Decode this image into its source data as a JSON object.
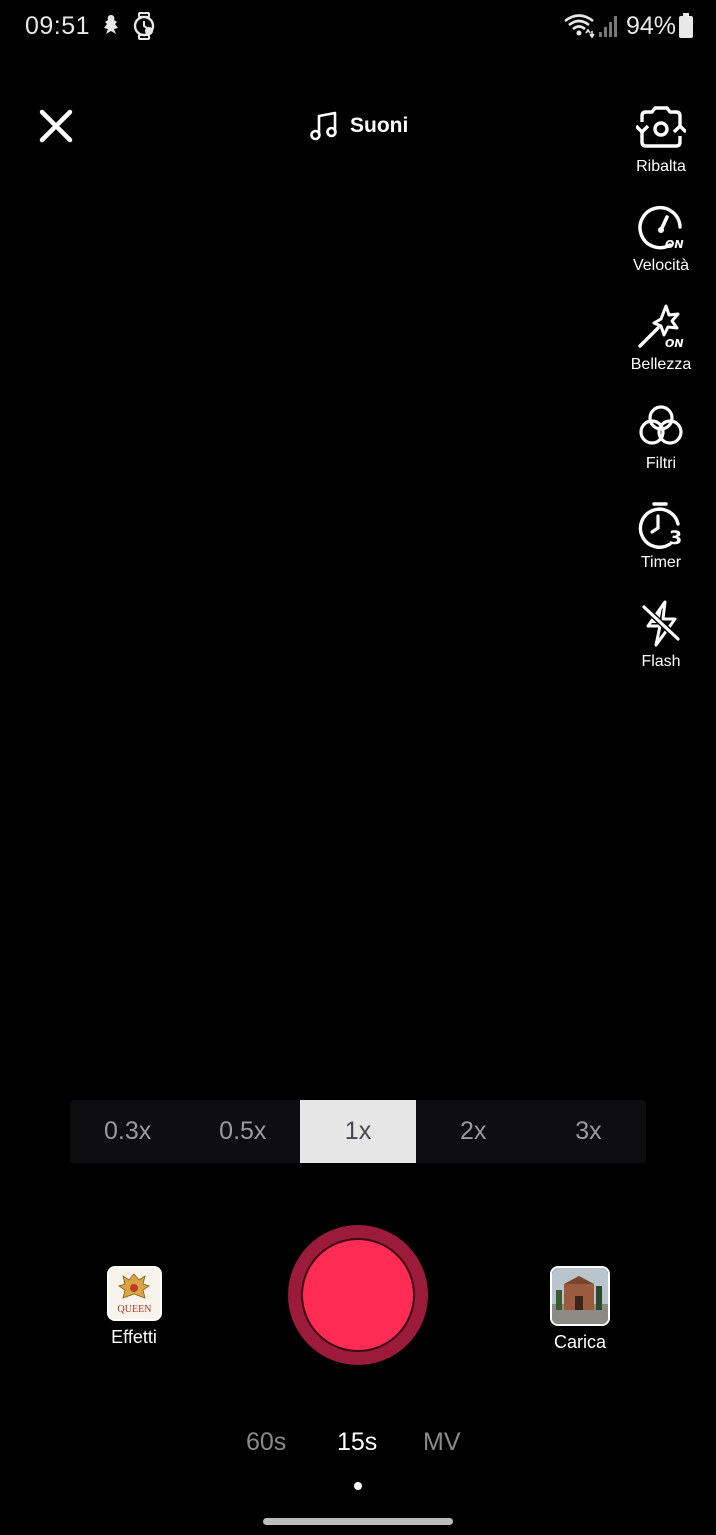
{
  "status_bar": {
    "time": "09:51",
    "battery": "94%"
  },
  "top_bar": {
    "sounds_label": "Suoni"
  },
  "side_tools": [
    {
      "id": "flip",
      "label": "Ribalta",
      "icon": "flip-camera-icon"
    },
    {
      "id": "speed",
      "label": "Velocità",
      "icon": "speed-icon",
      "badge": "ON"
    },
    {
      "id": "beauty",
      "label": "Bellezza",
      "icon": "beauty-wand-icon",
      "badge": "ON"
    },
    {
      "id": "filters",
      "label": "Filtri",
      "icon": "filters-icon"
    },
    {
      "id": "timer",
      "label": "Timer",
      "icon": "timer-icon",
      "badge": "3"
    },
    {
      "id": "flash",
      "label": "Flash",
      "icon": "flash-off-icon"
    }
  ],
  "zoom": {
    "options": [
      "0.3x",
      "0.5x",
      "1x",
      "2x",
      "3x"
    ],
    "selected": "1x"
  },
  "effects": {
    "label": "Effetti",
    "thumb_text": "QUEEN"
  },
  "upload": {
    "label": "Carica"
  },
  "modes": {
    "items": [
      "60s",
      "15s",
      "MV"
    ],
    "selected": "15s"
  },
  "colors": {
    "record": "#fe2c55",
    "record_ring": "#9c1b3a",
    "background": "#000000"
  }
}
